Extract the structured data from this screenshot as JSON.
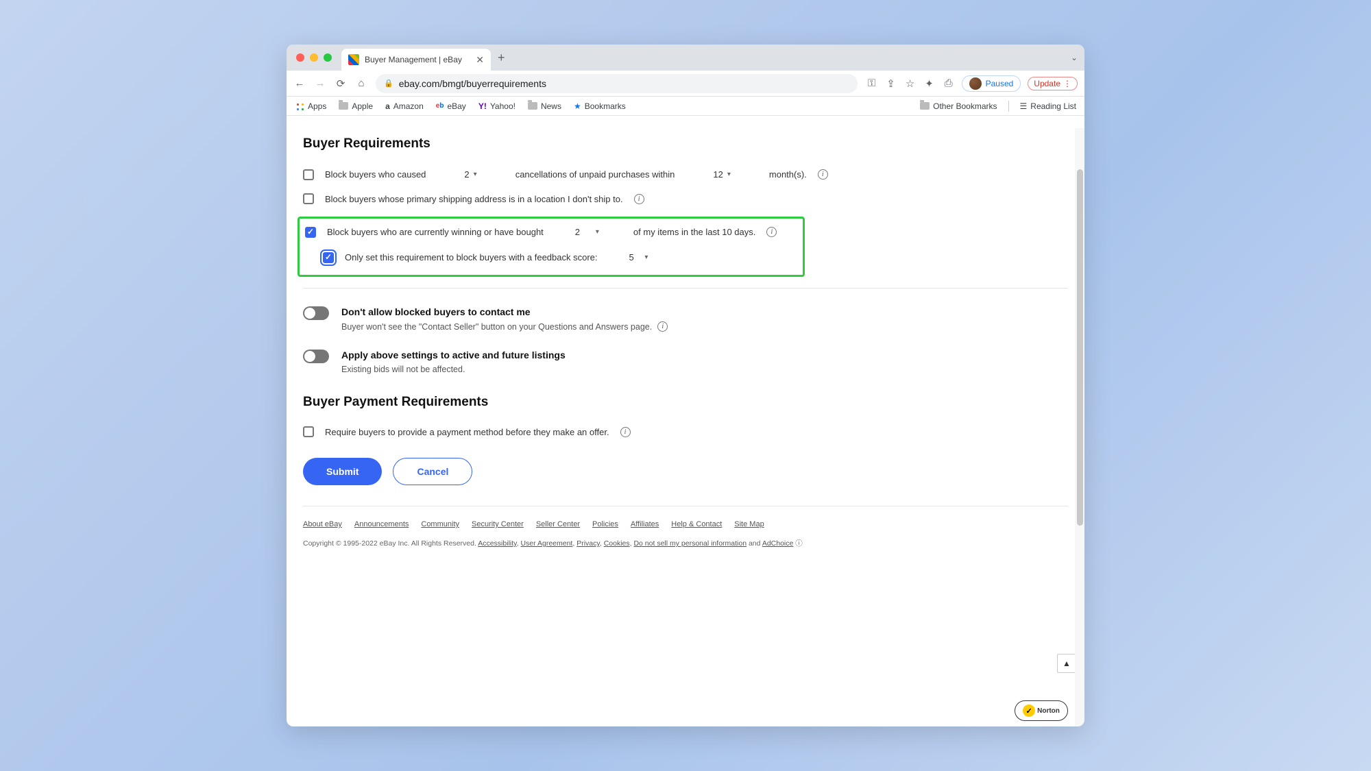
{
  "tab": {
    "title": "Buyer Management | eBay"
  },
  "url": "ebay.com/bmgt/buyerrequirements",
  "profile": {
    "status": "Paused",
    "update": "Update"
  },
  "bookmarks": {
    "apps": "Apps",
    "apple": "Apple",
    "amazon": "Amazon",
    "ebay": "eBay",
    "yahoo": "Yahoo!",
    "news": "News",
    "bookmarks": "Bookmarks",
    "other": "Other Bookmarks",
    "reading": "Reading List"
  },
  "page": {
    "h1": "Buyer Requirements",
    "row1": {
      "label_a": "Block buyers who caused",
      "val_a": "2",
      "label_b": "cancellations of unpaid purchases within",
      "val_b": "12",
      "label_c": "month(s)."
    },
    "row2": {
      "label": "Block buyers whose primary shipping address is in a location I don't ship to."
    },
    "row3": {
      "label_a": "Block buyers who are currently winning or have bought",
      "val_a": "2",
      "label_b": "of my items in the last 10 days."
    },
    "row3b": {
      "label": "Only set this requirement to block buyers with a feedback score:",
      "val": "5"
    },
    "tog1": {
      "title": "Don't allow blocked buyers to contact me",
      "desc": "Buyer won't see the \"Contact Seller\" button on your Questions and Answers page."
    },
    "tog2": {
      "title": "Apply above settings to active and future listings",
      "desc": "Existing bids will not be affected."
    },
    "h2": "Buyer Payment Requirements",
    "row4": {
      "label": "Require buyers to provide a payment method before they make an offer."
    },
    "submit": "Submit",
    "cancel": "Cancel"
  },
  "footer": {
    "links": [
      "About eBay",
      "Announcements",
      "Community",
      "Security Center",
      "Seller Center",
      "Policies",
      "Affiliates",
      "Help & Contact",
      "Site Map"
    ],
    "copy_a": "Copyright © 1995-2022 eBay Inc. All Rights Reserved. ",
    "copy_links": [
      "Accessibility",
      "User Agreement",
      "Privacy",
      "Cookies",
      "Do not sell my personal information"
    ],
    "copy_and": " and ",
    "copy_ad": "AdChoice",
    "norton": "Norton"
  }
}
